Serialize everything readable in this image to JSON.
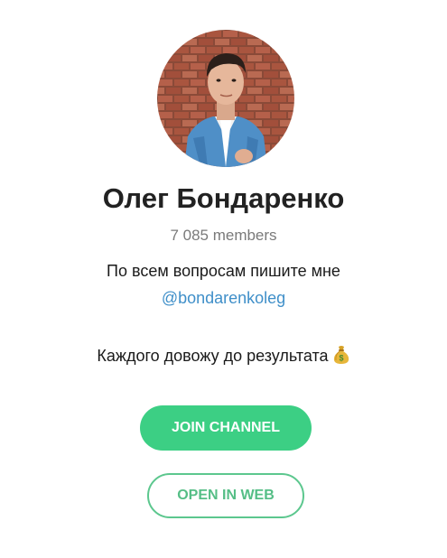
{
  "channel": {
    "name": "Олег Бондаренко",
    "members": "7 085 members",
    "description_line1": "По всем вопросам пишите мне",
    "description_link": "@bondarenkoleg",
    "description_line2": "Каждого довожу до результата",
    "description_emoji": "money-bag-icon",
    "avatar": "profile-photo"
  },
  "buttons": {
    "join": "JOIN CHANNEL",
    "open_web": "OPEN IN WEB"
  },
  "colors": {
    "accent_green": "#3ccf84",
    "link_blue": "#3f8fc9",
    "title": "#222222",
    "muted": "#7a7a7a"
  }
}
